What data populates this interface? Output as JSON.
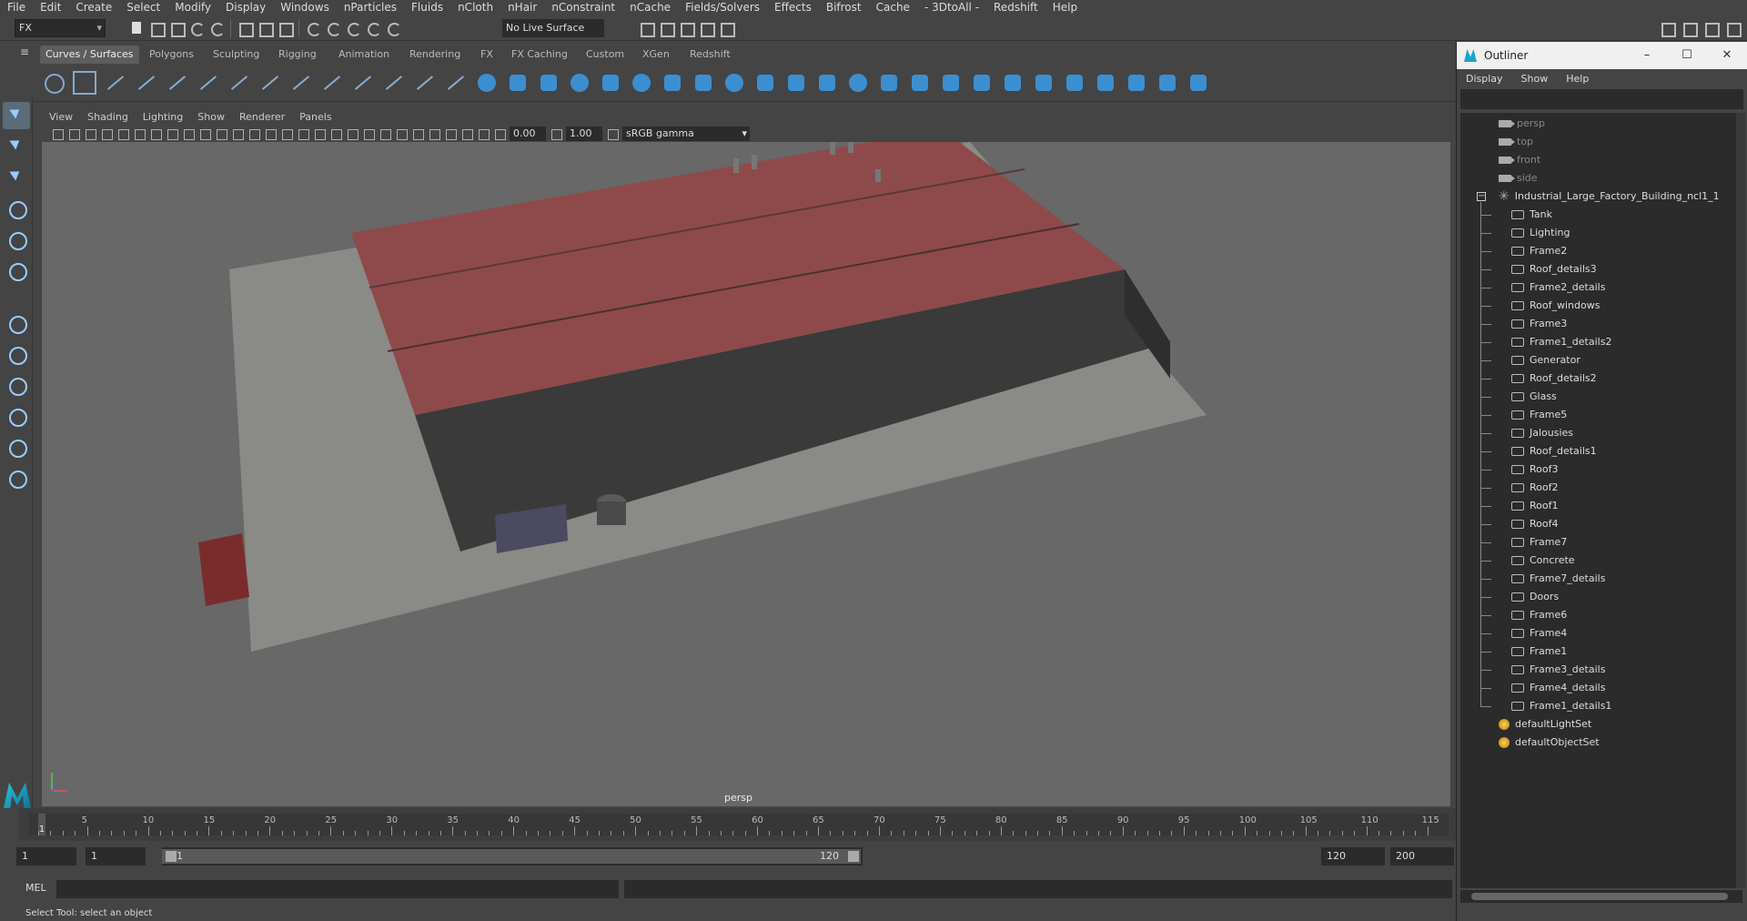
{
  "menubar": [
    "File",
    "Edit",
    "Create",
    "Select",
    "Modify",
    "Display",
    "Windows",
    "nParticles",
    "Fluids",
    "nCloth",
    "nHair",
    "nConstraint",
    "nCache",
    "Fields/Solvers",
    "Effects",
    "Bifrost",
    "Cache",
    "- 3DtoAll -",
    "Redshift",
    "Help"
  ],
  "toolbar": {
    "mode": "FX",
    "live_surface": "No Live Surface"
  },
  "shelf_tabs": [
    "Curves / Surfaces",
    "Polygons",
    "Sculpting",
    "Rigging",
    "Animation",
    "Rendering",
    "FX",
    "FX Caching",
    "Custom",
    "XGen",
    "Redshift"
  ],
  "active_shelf": "Curves / Surfaces",
  "viewport": {
    "menu": [
      "View",
      "Shading",
      "Lighting",
      "Show",
      "Renderer",
      "Panels"
    ],
    "exposure": "0.00",
    "gamma_value": "1.00",
    "color_space": "sRGB gamma",
    "camera_label": "persp"
  },
  "timeline": {
    "ticks": [
      "5",
      "10",
      "15",
      "20",
      "25",
      "30",
      "35",
      "40",
      "45",
      "50",
      "55",
      "60",
      "65",
      "70",
      "75",
      "80",
      "85",
      "90",
      "95",
      "100",
      "105",
      "110",
      "115"
    ],
    "current": "1"
  },
  "range": {
    "start": "1",
    "anim_start": "1",
    "slider_start": "1",
    "slider_end": "120",
    "anim_end": "120",
    "end": "200"
  },
  "cmd": {
    "label": "MEL"
  },
  "status": "Select Tool: select an object",
  "outliner": {
    "title": "Outliner",
    "menu": [
      "Display",
      "Show",
      "Help"
    ],
    "cameras": [
      "persp",
      "top",
      "front",
      "side"
    ],
    "root": "Industrial_Large_Factory_Building_ncl1_1",
    "children": [
      "Tank",
      "Lighting",
      "Frame2",
      "Roof_details3",
      "Frame2_details",
      "Roof_windows",
      "Frame3",
      "Frame1_details2",
      "Generator",
      "Roof_details2",
      "Glass",
      "Frame5",
      "Jalousies",
      "Roof_details1",
      "Roof3",
      "Roof2",
      "Roof1",
      "Roof4",
      "Frame7",
      "Concrete",
      "Frame7_details",
      "Doors",
      "Frame6",
      "Frame4",
      "Frame1",
      "Frame3_details",
      "Frame4_details",
      "Frame1_details1"
    ],
    "sets": [
      "defaultLightSet",
      "defaultObjectSet"
    ]
  }
}
